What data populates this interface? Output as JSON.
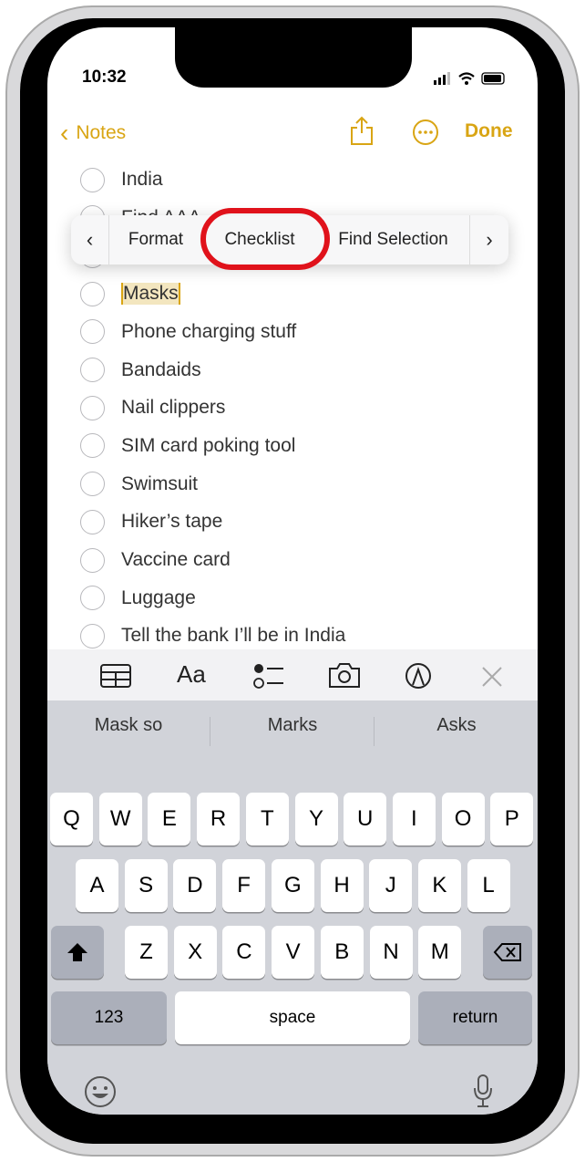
{
  "status": {
    "time": "10:32"
  },
  "nav": {
    "back_label": "Notes",
    "done_label": "Done",
    "back_icon": "chevron-left-icon",
    "share_icon": "share-icon",
    "more_icon": "ellipsis-circle-icon"
  },
  "checklist": [
    {
      "label": "India"
    },
    {
      "label": "Find AAA"
    },
    {
      "label": ""
    },
    {
      "label": "Masks",
      "selected": true
    },
    {
      "label": "Phone charging stuff"
    },
    {
      "label": "Bandaids"
    },
    {
      "label": "Nail clippers"
    },
    {
      "label": "SIM card poking tool"
    },
    {
      "label": "Swimsuit"
    },
    {
      "label": "Hiker’s tape"
    },
    {
      "label": "Vaccine card"
    },
    {
      "label": "Luggage"
    },
    {
      "label": "Tell the bank I’ll be in India"
    }
  ],
  "context_menu": {
    "items": [
      "Format",
      "Checklist",
      "Find Selection"
    ],
    "highlighted": "Checklist",
    "highlight_color": "#e0121b"
  },
  "toolbar": {
    "icons": [
      "table-icon",
      "text-format-icon",
      "checklist-icon",
      "camera-icon",
      "markup-icon",
      "close-icon"
    ],
    "format_label": "Aa"
  },
  "suggestions": [
    "Mask so",
    "Marks",
    "Asks"
  ],
  "keyboard": {
    "row1": [
      "Q",
      "W",
      "E",
      "R",
      "T",
      "Y",
      "U",
      "I",
      "O",
      "P"
    ],
    "row2": [
      "A",
      "S",
      "D",
      "F",
      "G",
      "H",
      "J",
      "K",
      "L"
    ],
    "row3": [
      "Z",
      "X",
      "C",
      "V",
      "B",
      "N",
      "M"
    ],
    "numbers_label": "123",
    "space_label": "space",
    "return_label": "return"
  },
  "colors": {
    "accent": "#d9a514",
    "selection": "#f3e6bf"
  }
}
